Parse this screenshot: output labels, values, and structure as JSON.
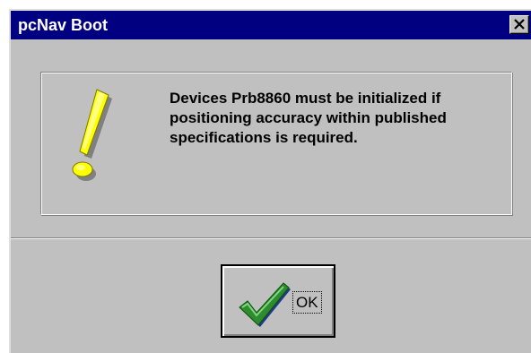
{
  "window": {
    "title": "pcNav Boot",
    "close_icon": "close-icon"
  },
  "message": {
    "icon": "exclamation-icon",
    "text": "Devices Prb8860 must be initialized if positioning accuracy within published specifications is required."
  },
  "buttons": {
    "ok_label": "OK",
    "ok_icon": "checkmark-icon"
  },
  "colors": {
    "titlebar": "#000080",
    "face": "#c0c0c0",
    "exclamation": "#ffff00",
    "check": "#2e8b2e"
  }
}
